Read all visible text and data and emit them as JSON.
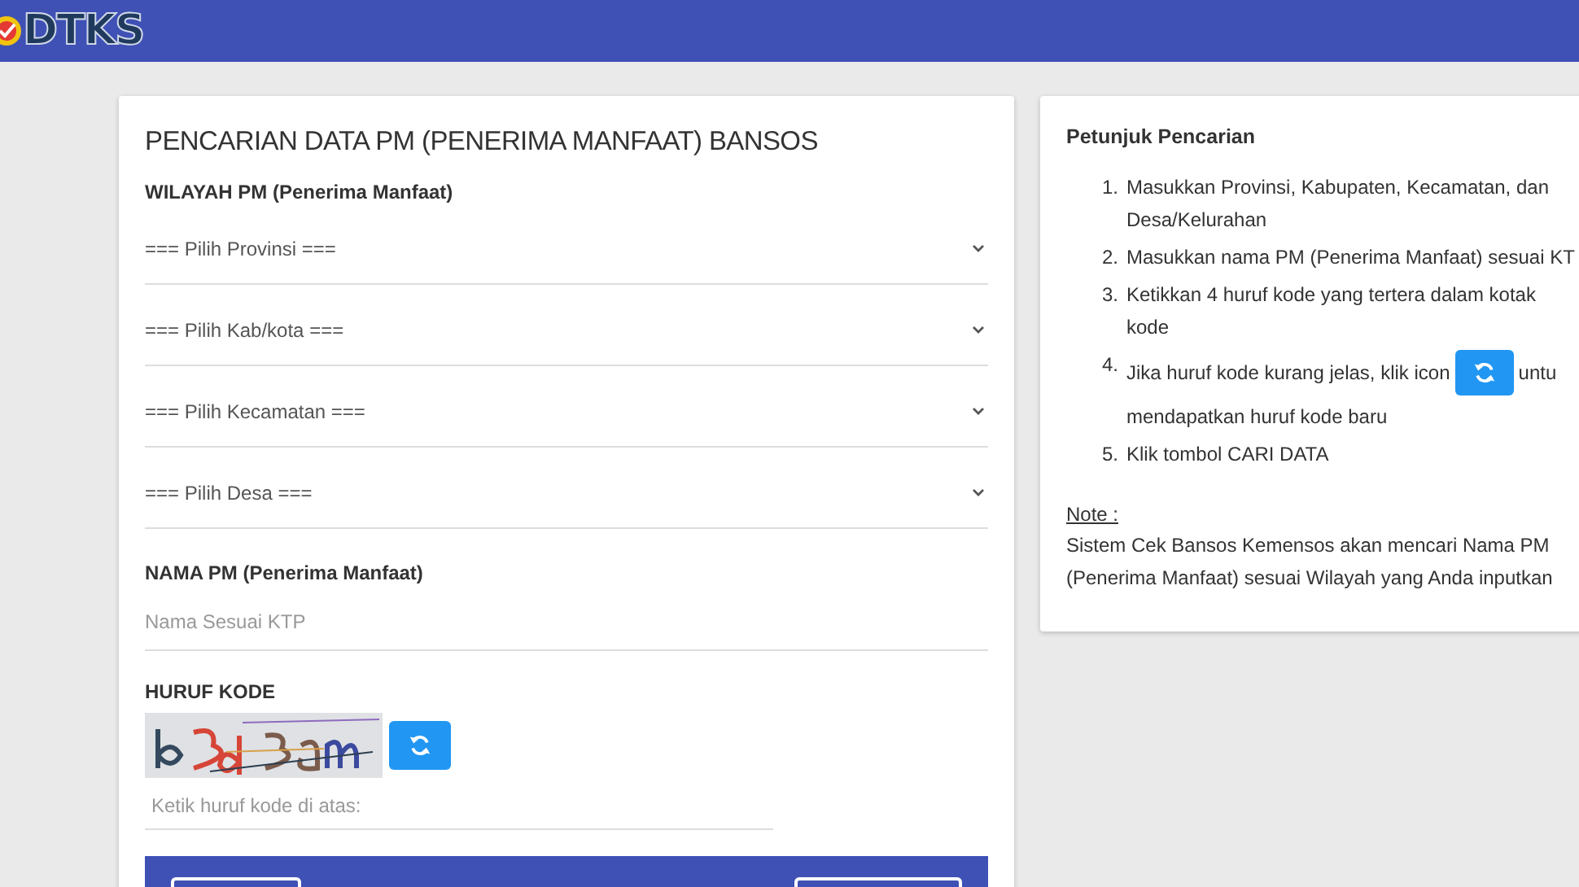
{
  "header": {
    "logo": "DTKS"
  },
  "form": {
    "title": "PENCARIAN DATA PM (PENERIMA MANFAAT) BANSOS",
    "region_label": "WILAYAH PM (Penerima Manfaat)",
    "selects": [
      {
        "value": "=== Pilih Provinsi ==="
      },
      {
        "value": "=== Pilih Kab/kota ==="
      },
      {
        "value": "=== Pilih Kecamatan ==="
      },
      {
        "value": "=== Pilih Desa ==="
      }
    ],
    "name_label": "NAMA PM (Penerima Manfaat)",
    "name_field": {
      "placeholder": "Nama Sesuai KTP"
    },
    "code_label": "HURUF KODE",
    "code_field": {
      "placeholder": "Ketik huruf kode di atas:"
    }
  },
  "help": {
    "title": "Petunjuk Pencarian",
    "steps": [
      {
        "number": "1.",
        "text": "Masukkan Provinsi, Kabupaten, Kecamatan, dan Desa/Kelurahan"
      },
      {
        "number": "2.",
        "text": "Masukkan nama PM (Penerima Manfaat) sesuai KT"
      },
      {
        "number": "3.",
        "text": "Ketikkan 4 huruf kode yang tertera dalam kotak kode"
      },
      {
        "number": "4.",
        "text": "Jika huruf kode kurang jelas, klik icon",
        "has_icon": true,
        "text_after": "untu",
        "text_next_line": "mendapatkan huruf kode baru"
      },
      {
        "number": "5.",
        "text": "Klik tombol CARI DATA"
      }
    ],
    "note_label": "Note :",
    "note": "Sistem Cek Bansos Kemensos akan mencari Nama PM (Penerima Manfaat) sesuai Wilayah yang Anda inputkan"
  }
}
